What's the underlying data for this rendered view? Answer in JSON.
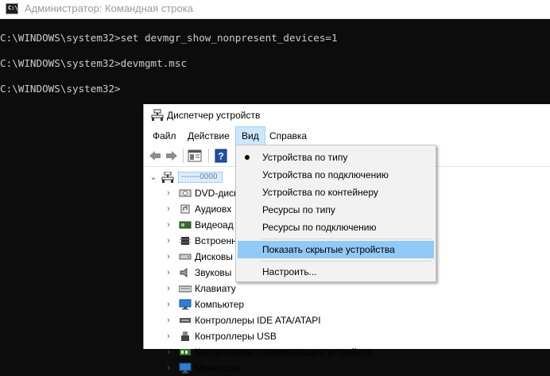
{
  "console": {
    "title": "Администратор: Командная строка",
    "icon_text": "C:\\_",
    "lines": [
      "C:\\WINDOWS\\system32>set devmgr_show_nonpresent_devices=1",
      "C:\\WINDOWS\\system32>devmgmt.msc",
      "C:\\WINDOWS\\system32>"
    ]
  },
  "devmgr": {
    "title": "Диспетчер устройств",
    "menu": [
      "Файл",
      "Действие",
      "Вид",
      "Справка"
    ],
    "active_menu": "Вид",
    "hostname": "-------0000",
    "tree": [
      "DVD-диск",
      "Аудиовх",
      "Видеоад",
      "Встроенн",
      "Дисковы",
      "Звуковы",
      "Клавиату",
      "Компьютер",
      "Контроллеры IDE ATA/ATAPI",
      "Контроллеры USB",
      "Контроллеры запоминающих устройств",
      "Мониторы"
    ]
  },
  "view_menu": {
    "items": [
      "Устройства по типу",
      "Устройства по подключению",
      "Устройства по контейнеру",
      "Ресурсы по типу",
      "Ресурсы по подключению",
      "Показать скрытые устройства",
      "Настроить..."
    ],
    "checked_item": "Устройства по типу",
    "highlighted_item": "Показать скрытые устройства"
  },
  "colors": {
    "console_bg": "#0c0c0c",
    "console_text": "#cccccc",
    "menu_highlight": "#91c9f7",
    "menu_active": "#cce8ff"
  }
}
